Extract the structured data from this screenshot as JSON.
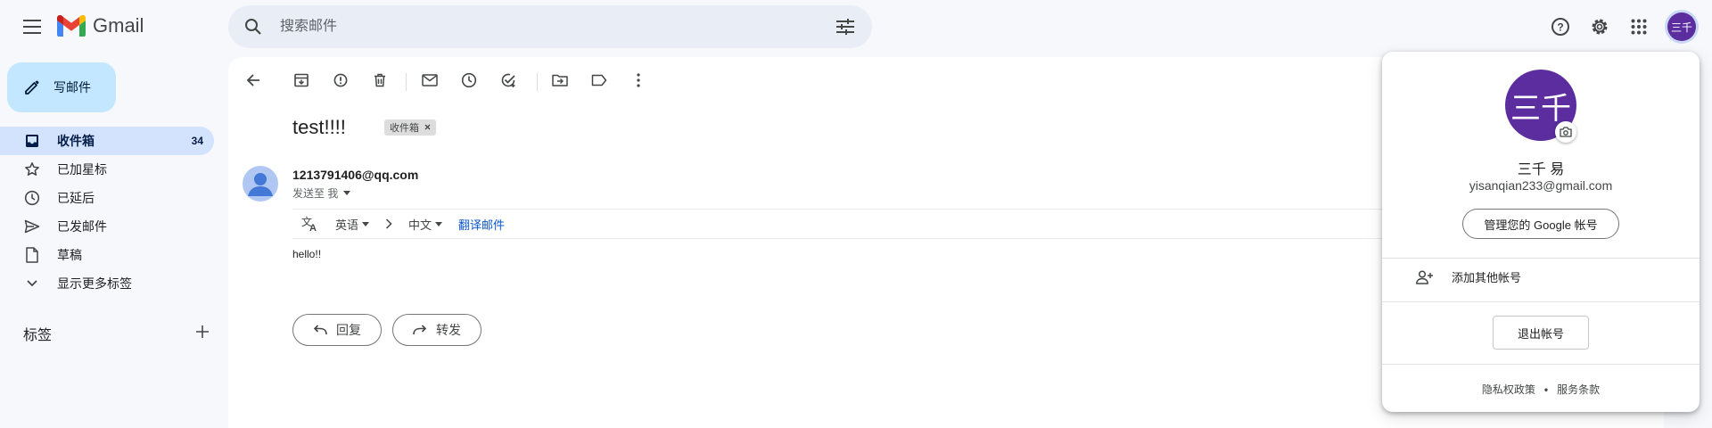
{
  "header": {
    "app_name": "Gmail",
    "search_placeholder": "搜索邮件",
    "account_initials": "三千"
  },
  "compose": {
    "label": "写邮件"
  },
  "sidebar": {
    "items": [
      {
        "label": "收件箱",
        "count": "34",
        "icon": "inbox-icon",
        "active": true
      },
      {
        "label": "已加星标",
        "icon": "star-icon"
      },
      {
        "label": "已延后",
        "icon": "clock-icon"
      },
      {
        "label": "已发邮件",
        "icon": "send-icon"
      },
      {
        "label": "草稿",
        "icon": "draft-icon"
      },
      {
        "label": "显示更多标签",
        "icon": "chevron-down-icon"
      }
    ],
    "labels_header": "标签"
  },
  "email": {
    "subject": "test!!!!",
    "label_chip": "收件箱",
    "sender": "1213791406@qq.com",
    "recipient": "发送至 我",
    "translate": {
      "source_lang": "英语",
      "target_lang": "中文",
      "action": "翻译邮件"
    },
    "body": "hello!!",
    "reply_label": "回复",
    "forward_label": "转发"
  },
  "account_popup": {
    "avatar_text": "三千",
    "name": "三千 易",
    "email": "yisanqian233@gmail.com",
    "manage_label": "管理您的 Google 帐号",
    "add_account_label": "添加其他帐号",
    "sign_out_label": "退出帐号",
    "privacy_label": "隐私权政策",
    "terms_label": "服务条款",
    "footer_dot": "•"
  },
  "colors": {
    "accent": "#0b57d0",
    "compose_bg": "#c2e7ff",
    "active_nav": "#d3e3fd",
    "avatar": "#5c2d9e"
  }
}
